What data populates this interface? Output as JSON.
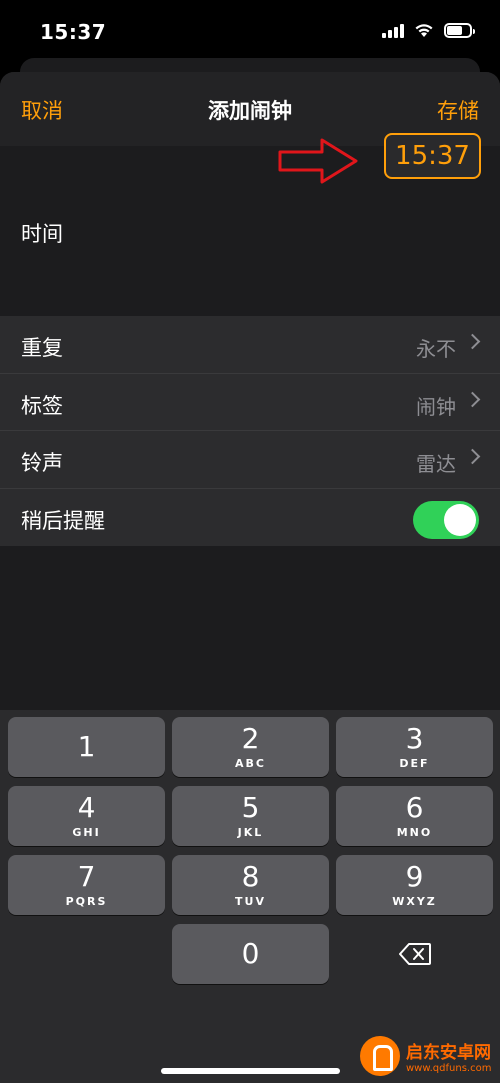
{
  "status_bar": {
    "time": "15:37"
  },
  "nav": {
    "cancel": "取消",
    "title": "添加闹钟",
    "save": "存储"
  },
  "time_section": {
    "label": "时间",
    "value": "15:37"
  },
  "rows": [
    {
      "label": "重复",
      "value": "永不"
    },
    {
      "label": "标签",
      "value": "闹钟"
    },
    {
      "label": "铃声",
      "value": "雷达"
    },
    {
      "label": "稍后提醒",
      "toggle_on": true
    }
  ],
  "keypad": [
    {
      "num": "1",
      "letters": ""
    },
    {
      "num": "2",
      "letters": "ABC"
    },
    {
      "num": "3",
      "letters": "DEF"
    },
    {
      "num": "4",
      "letters": "GHI"
    },
    {
      "num": "5",
      "letters": "JKL"
    },
    {
      "num": "6",
      "letters": "MNO"
    },
    {
      "num": "7",
      "letters": "PQRS"
    },
    {
      "num": "8",
      "letters": "TUV"
    },
    {
      "num": "9",
      "letters": "WXYZ"
    },
    {
      "num": "0",
      "letters": ""
    }
  ],
  "watermark": {
    "name": "启东安卓网",
    "url": "www.qdfuns.com"
  },
  "colors": {
    "accent": "#ff9f0a",
    "toggle": "#30d158",
    "arrow": "#e0161b"
  }
}
